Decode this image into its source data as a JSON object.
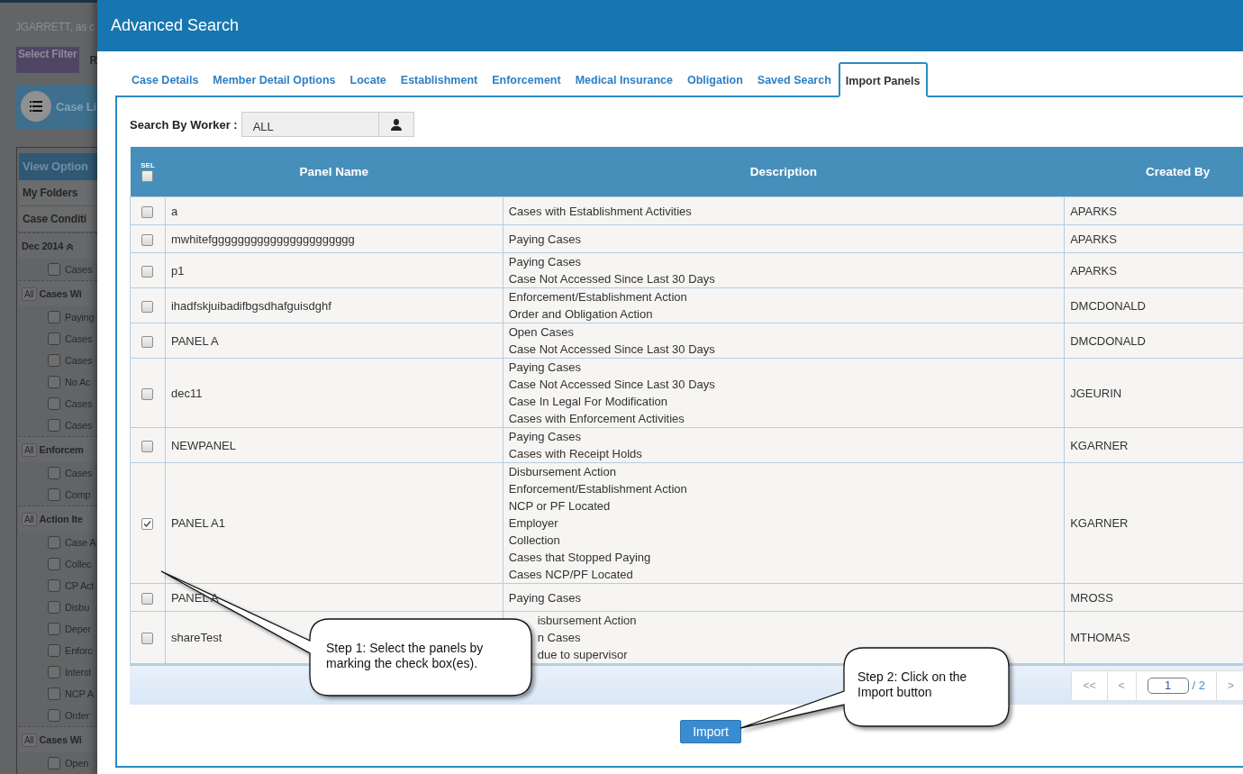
{
  "background_app": {
    "user_line": "JGARRETT, as c",
    "filter_button": "Select Filter",
    "filter_tab": "R",
    "case_list_button": "Case Li",
    "view_options": "View Option",
    "links": [
      "My Folders",
      "Case Conditi"
    ],
    "groups": [
      {
        "label": "Dec 2014",
        "expanded": true,
        "items": [
          {
            "label": "Cases",
            "checked": false
          }
        ]
      },
      {
        "all": "All",
        "label": "Cases Wi",
        "items": [
          {
            "label": "Paying",
            "checked": false
          },
          {
            "label": "Cases",
            "checked": false
          },
          {
            "label": "Cases",
            "checked": false
          },
          {
            "label": "No Ac",
            "checked": false
          },
          {
            "label": "Cases",
            "checked": false
          },
          {
            "label": "Cases",
            "checked": false
          }
        ]
      },
      {
        "all": "All",
        "label": "Enforcem",
        "items": [
          {
            "label": "Cases",
            "checked": false
          },
          {
            "label": "Comp",
            "checked": false
          }
        ]
      },
      {
        "all": "All",
        "label": "Action Ite",
        "items": [
          {
            "label": "Case A",
            "checked": false
          },
          {
            "label": "Collec",
            "checked": false
          },
          {
            "label": "CP Act",
            "checked": false
          },
          {
            "label": "Disbu",
            "checked": false
          },
          {
            "label": "Deper",
            "checked": false
          },
          {
            "label": "Enforc",
            "checked": false
          },
          {
            "label": "Interst",
            "checked": false
          },
          {
            "label": "NCP A",
            "checked": false
          },
          {
            "label": "Order",
            "checked": false
          }
        ]
      },
      {
        "all": "All",
        "label": "Cases Wi",
        "items": [
          {
            "label": "Open",
            "checked": false
          }
        ]
      }
    ]
  },
  "dialog": {
    "title": "Advanced Search",
    "tabs": [
      {
        "label": "Case Details",
        "selected": false
      },
      {
        "label": "Member Detail Options",
        "selected": false
      },
      {
        "label": "Locate",
        "selected": false
      },
      {
        "label": "Establishment",
        "selected": false
      },
      {
        "label": "Enforcement",
        "selected": false
      },
      {
        "label": "Medical Insurance",
        "selected": false
      },
      {
        "label": "Obligation",
        "selected": false
      },
      {
        "label": "Saved Search",
        "selected": false
      },
      {
        "label": "Import Panels",
        "selected": true
      }
    ],
    "worker_filter": {
      "label": "Search By Worker :",
      "value": "ALL"
    },
    "table": {
      "columns": [
        "SEL",
        "Panel Name",
        "Description",
        "Created By"
      ],
      "select_all_checked": false,
      "rows": [
        {
          "checked": false,
          "name": "a",
          "description": [
            "Cases with Establishment Activities"
          ],
          "created_by": "APARKS",
          "partly_covered": false
        },
        {
          "checked": false,
          "name": "mwhitefgggggggggggggggggggggg",
          "description": [
            "Paying Cases"
          ],
          "created_by": "APARKS",
          "partly_covered": false
        },
        {
          "checked": false,
          "name": "p1",
          "description": [
            "Paying Cases",
            "Case Not Accessed Since Last 30 Days"
          ],
          "created_by": "APARKS",
          "partly_covered": false
        },
        {
          "checked": false,
          "name": "ihadfskjuibadifbgsdhafguisdghf",
          "description": [
            "Enforcement/Establishment Action",
            "Order and Obligation Action"
          ],
          "created_by": "DMCDONALD",
          "partly_covered": false
        },
        {
          "checked": false,
          "name": "PANEL A",
          "description": [
            "Open Cases",
            "Case Not Accessed Since Last 30 Days"
          ],
          "created_by": "DMCDONALD",
          "partly_covered": false
        },
        {
          "checked": false,
          "name": "dec11",
          "description": [
            "Paying Cases",
            "Case Not Accessed Since Last 30 Days",
            "Case In Legal For Modification",
            "Cases with Enforcement Activities"
          ],
          "created_by": "JGEURIN",
          "partly_covered": false
        },
        {
          "checked": false,
          "name": "NEWPANEL",
          "description": [
            "Paying Cases",
            "Cases with Receipt Holds"
          ],
          "created_by": "KGARNER",
          "partly_covered": false
        },
        {
          "checked": true,
          "name": "PANEL A1",
          "description": [
            "Disbursement Action",
            "Enforcement/Establishment Action",
            "NCP or PF Located",
            "Employer",
            "Collection",
            "Cases that Stopped Paying",
            "Cases NCP/PF Located"
          ],
          "created_by": "KGARNER",
          "partly_covered": false
        },
        {
          "checked": false,
          "name": "PANEL A",
          "description": [
            "Paying Cases"
          ],
          "created_by": "MROSS",
          "partly_covered": false
        },
        {
          "checked": false,
          "name": "shareTest",
          "description": [
            "isbursement Action",
            "n Cases",
            "due to supervisor"
          ],
          "created_by": "MTHOMAS",
          "partly_covered": true
        }
      ]
    },
    "pagination": {
      "first": "<<",
      "previous": "<",
      "page": "1",
      "total": "/ 2",
      "next": ">"
    },
    "import_button": "Import"
  },
  "callouts": [
    {
      "text": "Step 1: Select the panels by marking the check box(es)."
    },
    {
      "text": "Step 2: Click on the Import button"
    }
  ]
}
